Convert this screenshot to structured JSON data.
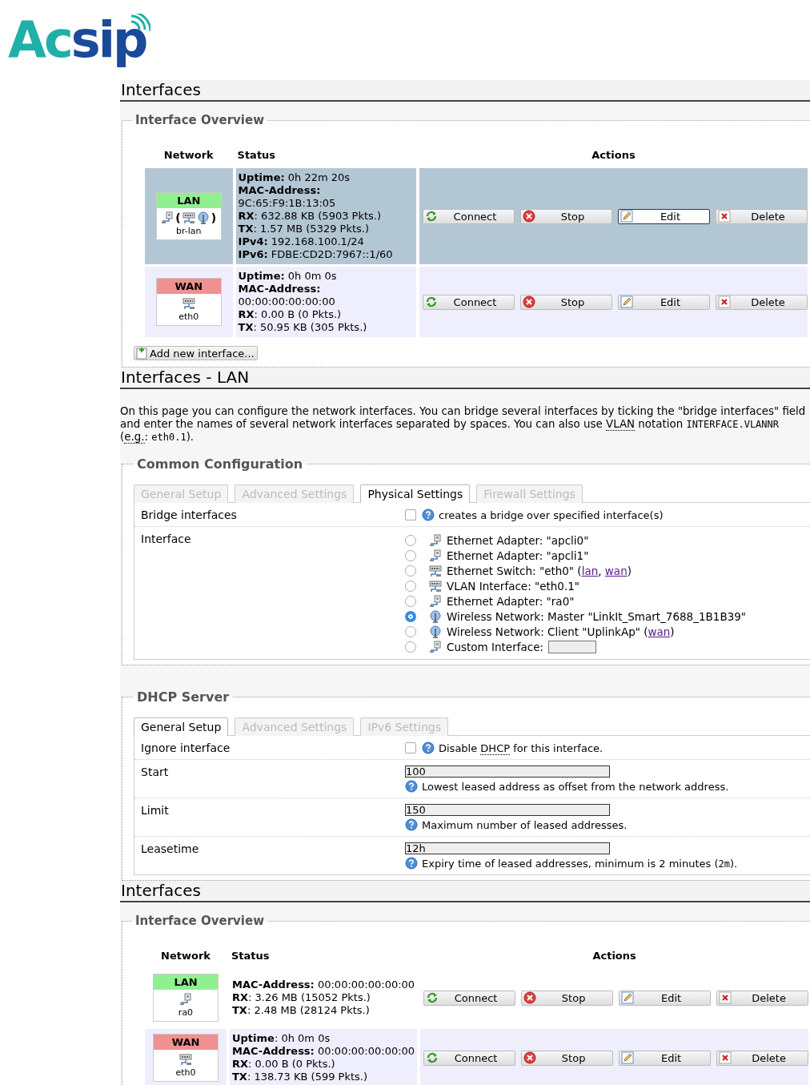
{
  "logo": {
    "first": "Ac",
    "second": "sip"
  },
  "sections": [
    {
      "kind": "overview",
      "heading": "Interfaces",
      "legend": "Interface Overview",
      "columns": [
        "Network",
        "Status",
        "Actions"
      ],
      "rows": [
        {
          "name": "LAN",
          "color": "#90f090",
          "selected": true,
          "device": "br-lan",
          "icons": [
            {
              "kind": "adapter"
            },
            {
              "kind": "paren",
              "text": "("
            },
            {
              "kind": "switch"
            },
            {
              "kind": "wireless"
            },
            {
              "kind": "paren",
              "text": ")"
            }
          ],
          "status": [
            "**Uptime:** 0h 22m 20s",
            "**MAC-Address:**",
            "9C:65:F9:1B:13:05",
            "**RX**: 632.88 KB (5903 Pkts.)",
            "**TX**: 1.57 MB (5329 Pkts.)",
            "**IPv4:** 192.168.100.1/24",
            "**IPv6:** FDBE:CD2D:7967::1/60"
          ],
          "actions": [
            {
              "kind": "connect",
              "label": "Connect",
              "focused": false
            },
            {
              "kind": "stop",
              "label": "Stop",
              "focused": false
            },
            {
              "kind": "edit",
              "label": "Edit",
              "focused": true
            },
            {
              "kind": "delete",
              "label": "Delete",
              "focused": false
            }
          ]
        },
        {
          "name": "WAN",
          "color": "#f09090",
          "selected": false,
          "device": "eth0",
          "icons": [
            {
              "kind": "switch"
            }
          ],
          "status": [
            "**Uptime:** 0h 0m 0s",
            "**MAC-Address:**",
            "00:00:00:00:00:00",
            "**RX**: 0.00 B (0 Pkts.)",
            "**TX**: 50.95 KB (305 Pkts.)"
          ],
          "actions": [
            {
              "kind": "connect",
              "label": "Connect",
              "focused": false
            },
            {
              "kind": "stop",
              "label": "Stop",
              "focused": false
            },
            {
              "kind": "edit",
              "label": "Edit",
              "focused": false
            },
            {
              "kind": "delete",
              "label": "Delete",
              "focused": false
            }
          ]
        }
      ],
      "add_button": "Add new interface..."
    },
    {
      "kind": "config",
      "heading": "Interfaces - LAN",
      "description": [
        {
          "kind": "text",
          "text": "On this page you can configure the network interfaces. You can bridge several interfaces by ticking the \"bridge interfaces\" field and enter the names of several network interfaces separated by spaces. You can also use "
        },
        {
          "kind": "abbr",
          "text": "VLAN"
        },
        {
          "kind": "text",
          "text": " notation "
        },
        {
          "kind": "code",
          "text": "INTERFACE.VLANNR"
        },
        {
          "kind": "text",
          "text": " ("
        },
        {
          "kind": "abbr",
          "text": "e.g."
        },
        {
          "kind": "text",
          "text": ": "
        },
        {
          "kind": "code",
          "text": "eth0.1"
        },
        {
          "kind": "text",
          "text": ")."
        }
      ],
      "legend": "Common Configuration",
      "tabs": [
        {
          "label": "General Setup",
          "selected": false
        },
        {
          "label": "Advanced Settings",
          "selected": false
        },
        {
          "label": "Physical Settings",
          "selected": true
        },
        {
          "label": "Firewall Settings",
          "selected": false
        }
      ],
      "fields": [
        {
          "kind": "checkbox",
          "label": "Bridge interfaces",
          "checked": false,
          "help": [
            {
              "kind": "text",
              "text": "creates a bridge over specified interface(s)"
            }
          ]
        },
        {
          "kind": "radios",
          "label": "Interface",
          "options": [
            {
              "selected": false,
              "kind": "adapter",
              "parts": [
                {
                  "kind": "text",
                  "text": "Ethernet Adapter: \"apcli0\""
                }
              ]
            },
            {
              "selected": false,
              "kind": "adapter",
              "parts": [
                {
                  "kind": "text",
                  "text": "Ethernet Adapter: \"apcli1\""
                }
              ]
            },
            {
              "selected": false,
              "kind": "switch",
              "parts": [
                {
                  "kind": "text",
                  "text": "Ethernet Switch: \"eth0\" ("
                },
                {
                  "kind": "link",
                  "text": "lan"
                },
                {
                  "kind": "text",
                  "text": ", "
                },
                {
                  "kind": "link",
                  "text": "wan"
                },
                {
                  "kind": "text",
                  "text": ")"
                }
              ]
            },
            {
              "selected": false,
              "kind": "switch",
              "parts": [
                {
                  "kind": "text",
                  "text": "VLAN Interface: \"eth0.1\""
                }
              ]
            },
            {
              "selected": false,
              "kind": "adapter",
              "parts": [
                {
                  "kind": "text",
                  "text": "Ethernet Adapter: \"ra0\""
                }
              ]
            },
            {
              "selected": true,
              "kind": "wireless",
              "parts": [
                {
                  "kind": "text",
                  "text": "Wireless Network: Master \"LinkIt_Smart_7688_1B1B39\""
                }
              ]
            },
            {
              "selected": false,
              "kind": "wireless",
              "parts": [
                {
                  "kind": "text",
                  "text": "Wireless Network: Client \"UplinkAp\" ("
                },
                {
                  "kind": "link",
                  "text": "wan"
                },
                {
                  "kind": "text",
                  "text": ")"
                }
              ]
            },
            {
              "selected": false,
              "kind": "custom",
              "parts": [
                {
                  "kind": "text",
                  "text": "Custom Interface:"
                }
              ]
            }
          ]
        }
      ]
    },
    {
      "kind": "config",
      "legend": "DHCP Server",
      "tabs": [
        {
          "label": "General Setup",
          "selected": true
        },
        {
          "label": "Advanced Settings",
          "selected": false
        },
        {
          "label": "IPv6 Settings",
          "selected": false
        }
      ],
      "fields": [
        {
          "kind": "checkbox",
          "label": "Ignore interface",
          "checked": false,
          "help": [
            {
              "kind": "text",
              "text": "Disable "
            },
            {
              "kind": "abbr",
              "text": "DHCP"
            },
            {
              "kind": "text",
              "text": " for this interface."
            }
          ]
        },
        {
          "kind": "text",
          "label": "Start",
          "value": "100",
          "help": [
            {
              "kind": "text",
              "text": "Lowest leased address as offset from the network address."
            }
          ]
        },
        {
          "kind": "text",
          "label": "Limit",
          "value": "150",
          "help": [
            {
              "kind": "text",
              "text": "Maximum number of leased addresses."
            }
          ]
        },
        {
          "kind": "text",
          "label": "Leasetime",
          "value": "12h",
          "help": [
            {
              "kind": "text",
              "text": "Expiry time of leased addresses, minimum is 2 minutes ("
            },
            {
              "kind": "code",
              "text": "2m"
            },
            {
              "kind": "text",
              "text": ")."
            }
          ]
        }
      ]
    },
    {
      "kind": "overview",
      "heading": "Interfaces",
      "legend": "Interface Overview",
      "columns": [
        "Network",
        "Status",
        "Actions"
      ],
      "rows": [
        {
          "name": "LAN",
          "color": "#90f090",
          "selected": false,
          "device": "ra0",
          "icons": [
            {
              "kind": "adapter"
            }
          ],
          "status": [
            "**MAC-Address:** 00:00:00:00:00:00",
            "**RX**: 3.26 MB (15052 Pkts.)",
            "**TX**: 2.48 MB (28124 Pkts.)"
          ],
          "actions": [
            {
              "kind": "connect",
              "label": "Connect",
              "focused": false
            },
            {
              "kind": "stop",
              "label": "Stop",
              "focused": false
            },
            {
              "kind": "edit",
              "label": "Edit",
              "focused": false
            },
            {
              "kind": "delete",
              "label": "Delete",
              "focused": false
            }
          ]
        },
        {
          "name": "WAN",
          "color": "#f09090",
          "selected": false,
          "device": "eth0",
          "icons": [
            {
              "kind": "switch"
            }
          ],
          "status": [
            "**Uptime**: 0h 0m 0s",
            "**MAC-Address:** 00:00:00:00:00:00",
            "**RX**: 0.00 B (0 Pkts.)",
            "**TX**: 138.73 KB (599 Pkts.)"
          ],
          "actions": [
            {
              "kind": "connect",
              "label": "Connect",
              "focused": false
            },
            {
              "kind": "stop",
              "label": "Stop",
              "focused": false
            },
            {
              "kind": "edit",
              "label": "Edit",
              "focused": false
            },
            {
              "kind": "delete",
              "label": "Delete",
              "focused": false
            }
          ]
        }
      ]
    }
  ]
}
